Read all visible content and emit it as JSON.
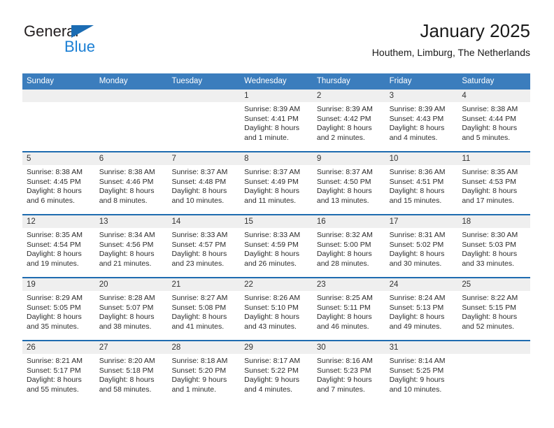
{
  "brand": {
    "name_part1": "General",
    "name_part2": "Blue",
    "triangle_color": "#1b6cb3",
    "blue_color": "#1b7fd4"
  },
  "header": {
    "title": "January 2025",
    "subtitle": "Houthem, Limburg, The Netherlands"
  },
  "theme": {
    "header_blue": "#3b7dbd",
    "rule_blue": "#1f6cb0",
    "day_band_gray": "#efefef"
  },
  "weekdays": [
    "Sunday",
    "Monday",
    "Tuesday",
    "Wednesday",
    "Thursday",
    "Friday",
    "Saturday"
  ],
  "weeks": [
    [
      {
        "day": "",
        "empty": true
      },
      {
        "day": "",
        "empty": true
      },
      {
        "day": "",
        "empty": true
      },
      {
        "day": "1",
        "sunrise": "Sunrise: 8:39 AM",
        "sunset": "Sunset: 4:41 PM",
        "daylight1": "Daylight: 8 hours",
        "daylight2": "and 1 minute."
      },
      {
        "day": "2",
        "sunrise": "Sunrise: 8:39 AM",
        "sunset": "Sunset: 4:42 PM",
        "daylight1": "Daylight: 8 hours",
        "daylight2": "and 2 minutes."
      },
      {
        "day": "3",
        "sunrise": "Sunrise: 8:39 AM",
        "sunset": "Sunset: 4:43 PM",
        "daylight1": "Daylight: 8 hours",
        "daylight2": "and 4 minutes."
      },
      {
        "day": "4",
        "sunrise": "Sunrise: 8:38 AM",
        "sunset": "Sunset: 4:44 PM",
        "daylight1": "Daylight: 8 hours",
        "daylight2": "and 5 minutes."
      }
    ],
    [
      {
        "day": "5",
        "sunrise": "Sunrise: 8:38 AM",
        "sunset": "Sunset: 4:45 PM",
        "daylight1": "Daylight: 8 hours",
        "daylight2": "and 6 minutes."
      },
      {
        "day": "6",
        "sunrise": "Sunrise: 8:38 AM",
        "sunset": "Sunset: 4:46 PM",
        "daylight1": "Daylight: 8 hours",
        "daylight2": "and 8 minutes."
      },
      {
        "day": "7",
        "sunrise": "Sunrise: 8:37 AM",
        "sunset": "Sunset: 4:48 PM",
        "daylight1": "Daylight: 8 hours",
        "daylight2": "and 10 minutes."
      },
      {
        "day": "8",
        "sunrise": "Sunrise: 8:37 AM",
        "sunset": "Sunset: 4:49 PM",
        "daylight1": "Daylight: 8 hours",
        "daylight2": "and 11 minutes."
      },
      {
        "day": "9",
        "sunrise": "Sunrise: 8:37 AM",
        "sunset": "Sunset: 4:50 PM",
        "daylight1": "Daylight: 8 hours",
        "daylight2": "and 13 minutes."
      },
      {
        "day": "10",
        "sunrise": "Sunrise: 8:36 AM",
        "sunset": "Sunset: 4:51 PM",
        "daylight1": "Daylight: 8 hours",
        "daylight2": "and 15 minutes."
      },
      {
        "day": "11",
        "sunrise": "Sunrise: 8:35 AM",
        "sunset": "Sunset: 4:53 PM",
        "daylight1": "Daylight: 8 hours",
        "daylight2": "and 17 minutes."
      }
    ],
    [
      {
        "day": "12",
        "sunrise": "Sunrise: 8:35 AM",
        "sunset": "Sunset: 4:54 PM",
        "daylight1": "Daylight: 8 hours",
        "daylight2": "and 19 minutes."
      },
      {
        "day": "13",
        "sunrise": "Sunrise: 8:34 AM",
        "sunset": "Sunset: 4:56 PM",
        "daylight1": "Daylight: 8 hours",
        "daylight2": "and 21 minutes."
      },
      {
        "day": "14",
        "sunrise": "Sunrise: 8:33 AM",
        "sunset": "Sunset: 4:57 PM",
        "daylight1": "Daylight: 8 hours",
        "daylight2": "and 23 minutes."
      },
      {
        "day": "15",
        "sunrise": "Sunrise: 8:33 AM",
        "sunset": "Sunset: 4:59 PM",
        "daylight1": "Daylight: 8 hours",
        "daylight2": "and 26 minutes."
      },
      {
        "day": "16",
        "sunrise": "Sunrise: 8:32 AM",
        "sunset": "Sunset: 5:00 PM",
        "daylight1": "Daylight: 8 hours",
        "daylight2": "and 28 minutes."
      },
      {
        "day": "17",
        "sunrise": "Sunrise: 8:31 AM",
        "sunset": "Sunset: 5:02 PM",
        "daylight1": "Daylight: 8 hours",
        "daylight2": "and 30 minutes."
      },
      {
        "day": "18",
        "sunrise": "Sunrise: 8:30 AM",
        "sunset": "Sunset: 5:03 PM",
        "daylight1": "Daylight: 8 hours",
        "daylight2": "and 33 minutes."
      }
    ],
    [
      {
        "day": "19",
        "sunrise": "Sunrise: 8:29 AM",
        "sunset": "Sunset: 5:05 PM",
        "daylight1": "Daylight: 8 hours",
        "daylight2": "and 35 minutes."
      },
      {
        "day": "20",
        "sunrise": "Sunrise: 8:28 AM",
        "sunset": "Sunset: 5:07 PM",
        "daylight1": "Daylight: 8 hours",
        "daylight2": "and 38 minutes."
      },
      {
        "day": "21",
        "sunrise": "Sunrise: 8:27 AM",
        "sunset": "Sunset: 5:08 PM",
        "daylight1": "Daylight: 8 hours",
        "daylight2": "and 41 minutes."
      },
      {
        "day": "22",
        "sunrise": "Sunrise: 8:26 AM",
        "sunset": "Sunset: 5:10 PM",
        "daylight1": "Daylight: 8 hours",
        "daylight2": "and 43 minutes."
      },
      {
        "day": "23",
        "sunrise": "Sunrise: 8:25 AM",
        "sunset": "Sunset: 5:11 PM",
        "daylight1": "Daylight: 8 hours",
        "daylight2": "and 46 minutes."
      },
      {
        "day": "24",
        "sunrise": "Sunrise: 8:24 AM",
        "sunset": "Sunset: 5:13 PM",
        "daylight1": "Daylight: 8 hours",
        "daylight2": "and 49 minutes."
      },
      {
        "day": "25",
        "sunrise": "Sunrise: 8:22 AM",
        "sunset": "Sunset: 5:15 PM",
        "daylight1": "Daylight: 8 hours",
        "daylight2": "and 52 minutes."
      }
    ],
    [
      {
        "day": "26",
        "sunrise": "Sunrise: 8:21 AM",
        "sunset": "Sunset: 5:17 PM",
        "daylight1": "Daylight: 8 hours",
        "daylight2": "and 55 minutes."
      },
      {
        "day": "27",
        "sunrise": "Sunrise: 8:20 AM",
        "sunset": "Sunset: 5:18 PM",
        "daylight1": "Daylight: 8 hours",
        "daylight2": "and 58 minutes."
      },
      {
        "day": "28",
        "sunrise": "Sunrise: 8:18 AM",
        "sunset": "Sunset: 5:20 PM",
        "daylight1": "Daylight: 9 hours",
        "daylight2": "and 1 minute."
      },
      {
        "day": "29",
        "sunrise": "Sunrise: 8:17 AM",
        "sunset": "Sunset: 5:22 PM",
        "daylight1": "Daylight: 9 hours",
        "daylight2": "and 4 minutes."
      },
      {
        "day": "30",
        "sunrise": "Sunrise: 8:16 AM",
        "sunset": "Sunset: 5:23 PM",
        "daylight1": "Daylight: 9 hours",
        "daylight2": "and 7 minutes."
      },
      {
        "day": "31",
        "sunrise": "Sunrise: 8:14 AM",
        "sunset": "Sunset: 5:25 PM",
        "daylight1": "Daylight: 9 hours",
        "daylight2": "and 10 minutes."
      },
      {
        "day": "",
        "empty": true
      }
    ]
  ]
}
